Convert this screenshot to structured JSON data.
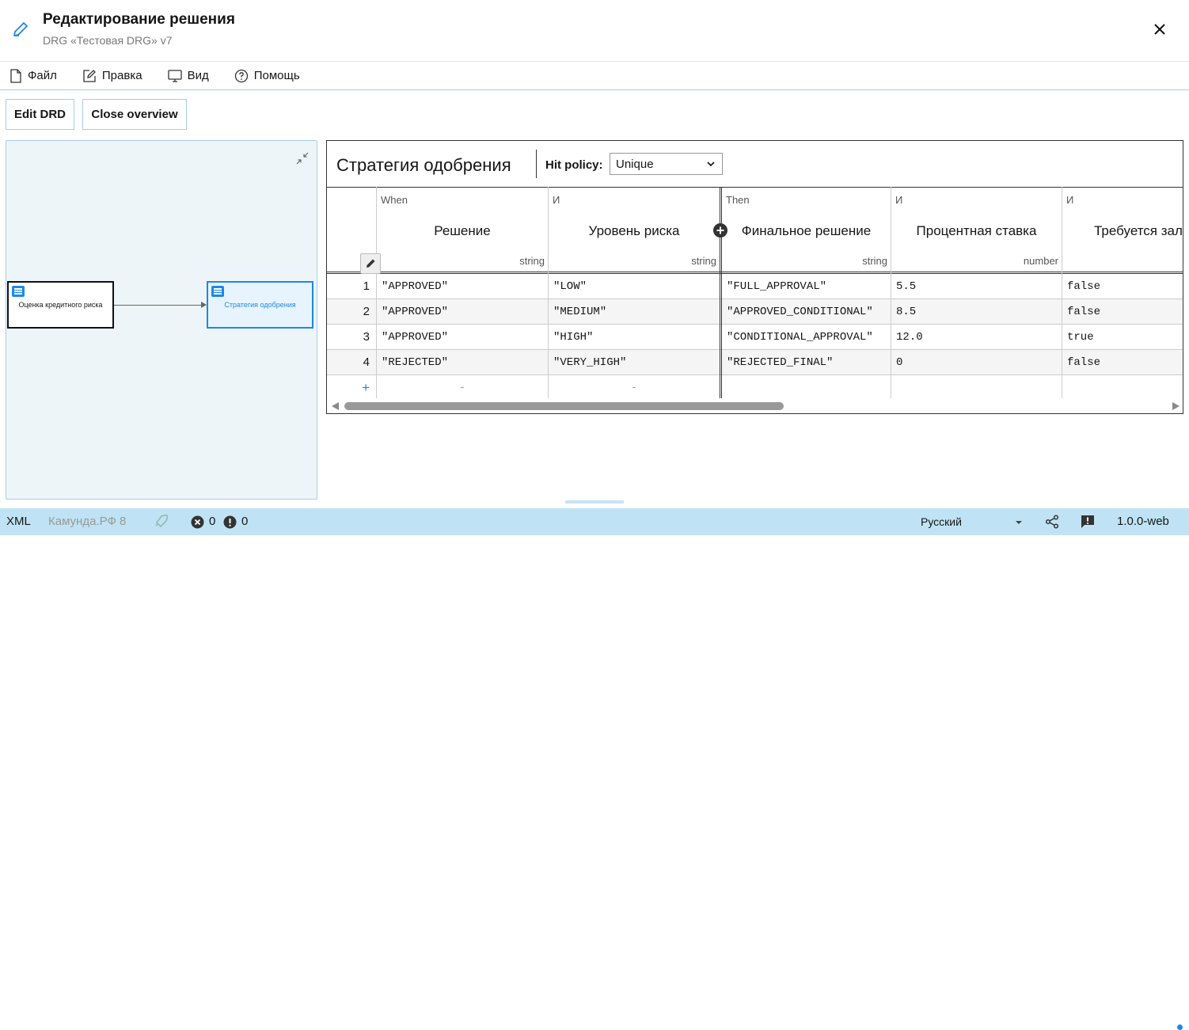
{
  "header": {
    "title": "Редактирование решения",
    "subtitle": "DRG «Тестовая DRG» v7"
  },
  "menu": [
    "Файл",
    "Правка",
    "Вид",
    "Помощь"
  ],
  "buttons": {
    "edit_drd": "Edit DRD",
    "close_overview": "Close overview"
  },
  "overview": {
    "nodes": [
      "Оценка кредитного риска",
      "Стратегия одобрения"
    ]
  },
  "decision_table": {
    "name": "Стратегия одобрения",
    "hit_policy_label": "Hit policy:",
    "hit_policy_value": "Unique",
    "columns": [
      {
        "clause": "When",
        "label": "Решение",
        "type": "string"
      },
      {
        "clause": "И",
        "label": "Уровень риска",
        "type": "string"
      },
      {
        "clause": "Then",
        "label": "Финальное решение",
        "type": "string"
      },
      {
        "clause": "И",
        "label": "Процентная ставка",
        "type": "number"
      },
      {
        "clause": "И",
        "label": "Требуется залог",
        "type": ""
      }
    ],
    "rows": [
      {
        "num": "1",
        "cells": [
          "\"APPROVED\"",
          "\"LOW\"",
          "\"FULL_APPROVAL\"",
          "5.5",
          "false"
        ]
      },
      {
        "num": "2",
        "cells": [
          "\"APPROVED\"",
          "\"MEDIUM\"",
          "\"APPROVED_CONDITIONAL\"",
          "8.5",
          "false"
        ]
      },
      {
        "num": "3",
        "cells": [
          "\"APPROVED\"",
          "\"HIGH\"",
          "\"CONDITIONAL_APPROVAL\"",
          "12.0",
          "true"
        ]
      },
      {
        "num": "4",
        "cells": [
          "\"REJECTED\"",
          "\"VERY_HIGH\"",
          "\"REJECTED_FINAL\"",
          "0",
          "false"
        ]
      }
    ],
    "add_row": "+",
    "empty_input": "-"
  },
  "status": {
    "xml": "XML",
    "engine": "Камунда.РФ 8",
    "errors": "0",
    "warnings": "0",
    "language": "Русский",
    "version": "1.0.0-web"
  },
  "colors": {
    "accent": "#1e88e5",
    "statusbar": "#bfe3f4"
  }
}
